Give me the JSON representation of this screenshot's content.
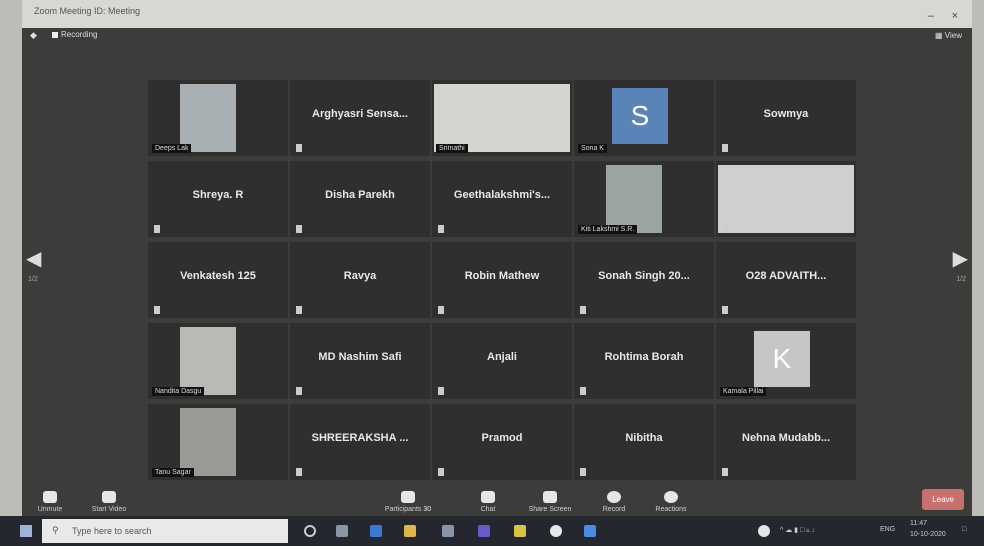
{
  "window": {
    "title": "Zoom Meeting ID: Meeting",
    "minimize": "–",
    "close": "×"
  },
  "topbar": {
    "recording": "Recording",
    "view": "View"
  },
  "nav": {
    "prev": "◀",
    "next": "▶",
    "page_left": "1/2",
    "page_right": "1/2"
  },
  "participants": [
    {
      "name": "",
      "label": "Deeps Lak",
      "video": true,
      "bg": "#a9b0b3"
    },
    {
      "name": "Arghyasri Sensa...",
      "label": "",
      "video": false
    },
    {
      "name": "",
      "label": "Srimathi",
      "video": true,
      "bg": "#d6d4d0"
    },
    {
      "name": "",
      "label": "Sona K",
      "video": false,
      "avatar": "S",
      "avatar_color": "#5a84b8"
    },
    {
      "name": "Sowmya",
      "label": "",
      "video": false
    },
    {
      "name": "Shreya. R",
      "label": "",
      "video": false
    },
    {
      "name": "Disha Parekh",
      "label": "",
      "video": false
    },
    {
      "name": "Geethalakshmi's...",
      "label": "",
      "video": false
    },
    {
      "name": "",
      "label": "Kiti Lakshmi S.R.",
      "video": true,
      "bg": "#9aa5a0"
    },
    {
      "name": "",
      "label": "",
      "video": true,
      "bg": "#cfcfcd"
    },
    {
      "name": "Venkatesh 125",
      "label": "",
      "video": false
    },
    {
      "name": "Ravya",
      "label": "",
      "video": false
    },
    {
      "name": "Robin Mathew",
      "label": "",
      "video": false
    },
    {
      "name": "Sonah Singh 20...",
      "label": "",
      "video": false
    },
    {
      "name": "O28 ADVAITH...",
      "label": "",
      "video": false
    },
    {
      "name": "",
      "label": "Nandita Dasgu",
      "video": true,
      "bg": "#b9b9b5"
    },
    {
      "name": "MD Nashim Safi",
      "label": "",
      "video": false
    },
    {
      "name": "Anjali",
      "label": "",
      "video": false
    },
    {
      "name": "Rohtima Borah",
      "label": "",
      "video": false
    },
    {
      "name": "",
      "label": "Kamala Pillai",
      "video": false,
      "avatar": "K",
      "avatar_color": "#c6c6c4"
    },
    {
      "name": "",
      "label": "Tanu Sagar",
      "video": true,
      "bg": "#9b9b95"
    },
    {
      "name": "SHREERAKSHA ...",
      "label": "",
      "video": false
    },
    {
      "name": "Pramod",
      "label": "",
      "video": false
    },
    {
      "name": "Nibitha",
      "label": "",
      "video": false
    },
    {
      "name": "Nehna Mudabb...",
      "label": "",
      "video": false
    }
  ],
  "toolbar": {
    "unmute": "Unmute",
    "start_video": "Start Video",
    "participants": "Participants",
    "participants_count": "30",
    "chat": "Chat",
    "share": "Share Screen",
    "record": "Record",
    "reactions": "Reactions",
    "leave": "Leave"
  },
  "taskbar": {
    "search_placeholder": "Type here to search",
    "lang": "ENG",
    "time": "11:47",
    "date": "10-10-2020"
  }
}
